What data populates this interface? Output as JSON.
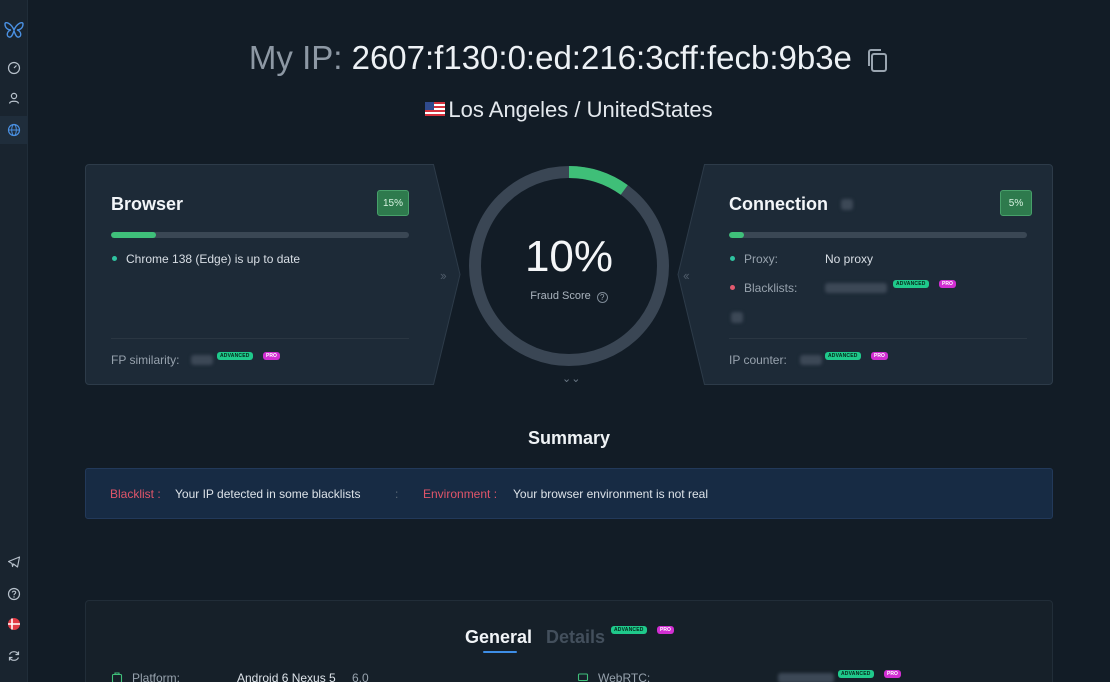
{
  "sidebar": {
    "items": [
      {
        "icon": "butterfly-logo-icon"
      },
      {
        "icon": "dashboard-gauge-icon"
      },
      {
        "icon": "user-icon"
      },
      {
        "icon": "globe-icon"
      },
      {
        "icon": "telegram-icon"
      },
      {
        "icon": "help-icon"
      },
      {
        "icon": "language-flag-icon"
      },
      {
        "icon": "refresh-icon"
      }
    ]
  },
  "header": {
    "ip_label": "My IP:",
    "ip_value": "2607:f130:0:ed:216:3cff:fecb:9b3e",
    "location": "Los Angeles / UnitedStates"
  },
  "browser_card": {
    "title": "Browser",
    "badge": "15%",
    "progress": 0.15,
    "status": "Chrome 138 (Edge) is up to date",
    "fp_label": "FP similarity:",
    "adv_tag": "ADVANCED",
    "pro_tag": "PRO"
  },
  "connection_card": {
    "title": "Connection",
    "badge": "5%",
    "progress": 0.05,
    "proxy_label": "Proxy:",
    "proxy_value": "No proxy",
    "blacklists_label": "Blacklists:",
    "ip_counter_label": "IP counter:",
    "adv_tag": "ADVANCED",
    "pro_tag": "PRO"
  },
  "gauge": {
    "value": "10%",
    "fraction": 0.1,
    "label": "Fraud Score",
    "info": "?"
  },
  "summary": {
    "title": "Summary",
    "items": [
      {
        "key": "Blacklist :",
        "value": "Your IP detected in some blacklists"
      },
      {
        "key": "Environment :",
        "value": "Your browser environment is not real"
      }
    ],
    "separator": ":"
  },
  "details_panel": {
    "tab_general": "General",
    "tab_details": "Details",
    "adv_tag": "ADVANCED",
    "pro_tag": "PRO",
    "platform_label": "Platform:",
    "platform_value": "Android 6 Nexus 5",
    "platform_version": "6.0",
    "webrtc_label": "WebRTC:"
  },
  "colors": {
    "background": "#121c26",
    "card": "#1d2a37",
    "accent_green": "#3fc07a",
    "alert_red": "#e0556a",
    "pro_magenta": "#d12ed2"
  }
}
